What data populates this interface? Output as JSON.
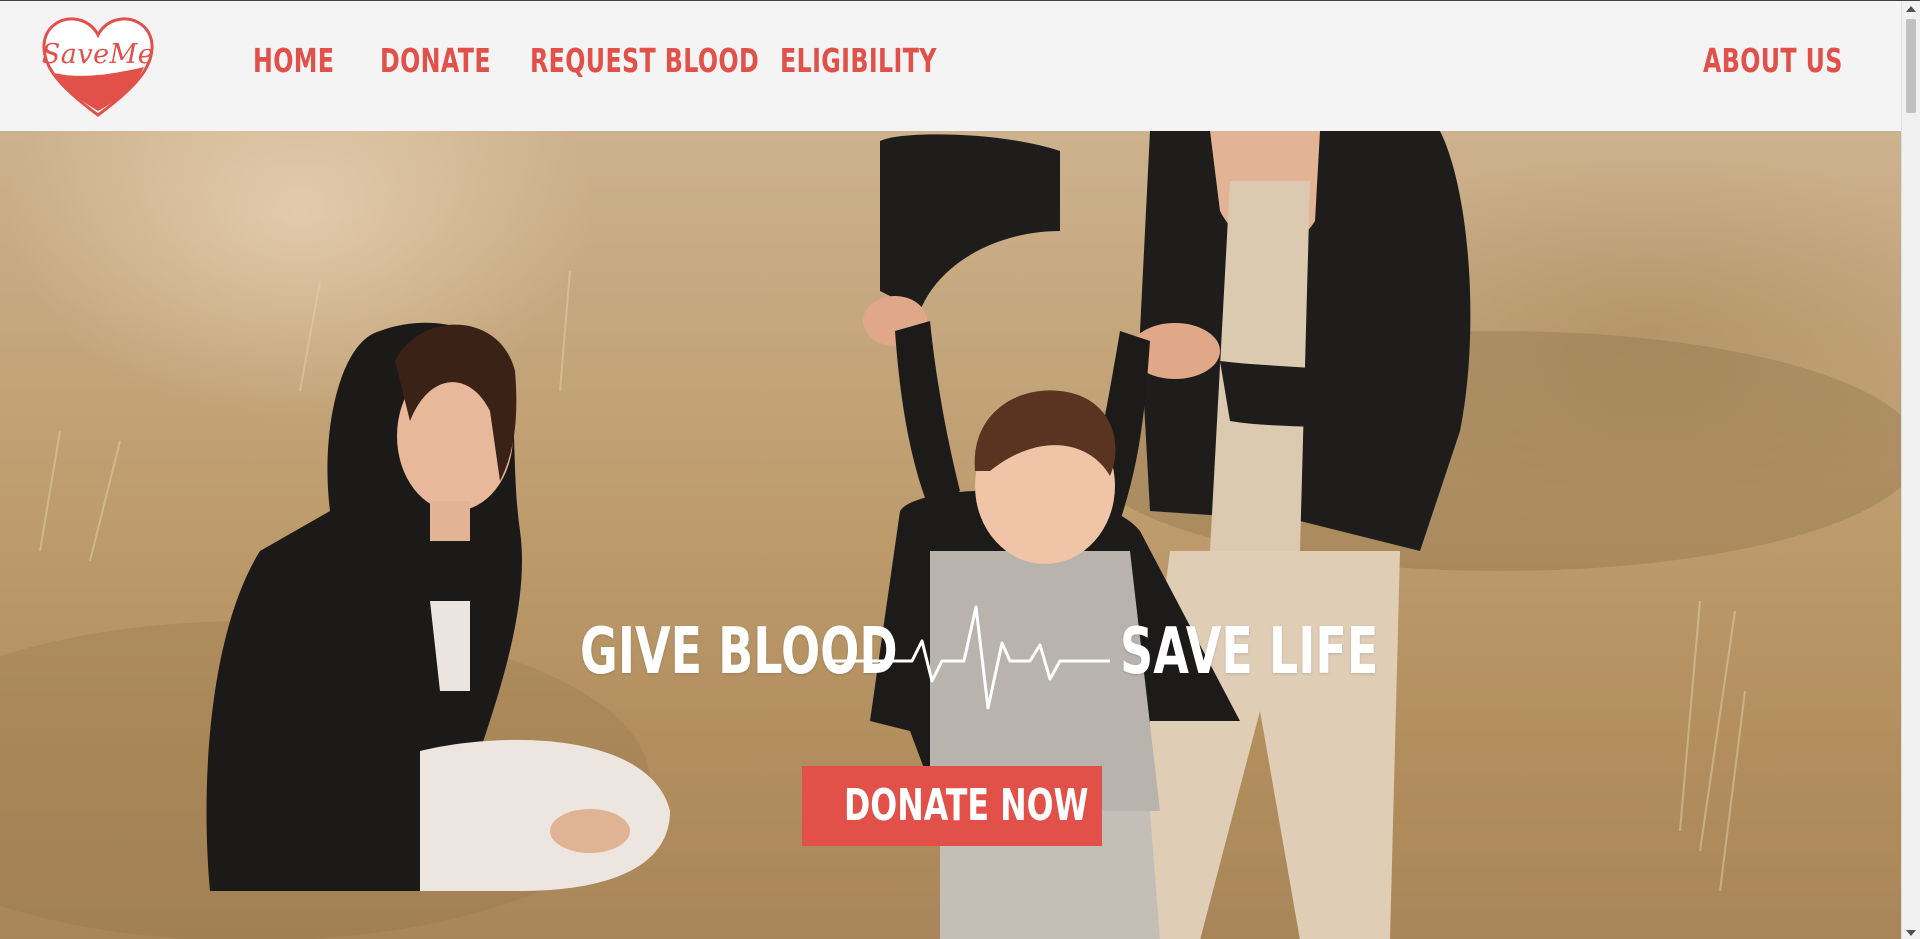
{
  "brand": {
    "logo_text": "SaveMe",
    "accent_color": "#e2504a"
  },
  "nav": {
    "items": [
      {
        "label": "HOME"
      },
      {
        "label": "DONATE"
      },
      {
        "label": "REQUEST BLOOD"
      },
      {
        "label": "ELIGIBILITY"
      }
    ],
    "about_label": "ABOUT US"
  },
  "hero": {
    "tagline_left": "GIVE BLOOD",
    "tagline_right": "SAVE LIFE",
    "divider_icon": "heartbeat-icon",
    "cta_label": "DONATE NOW",
    "background": "family-photo"
  }
}
